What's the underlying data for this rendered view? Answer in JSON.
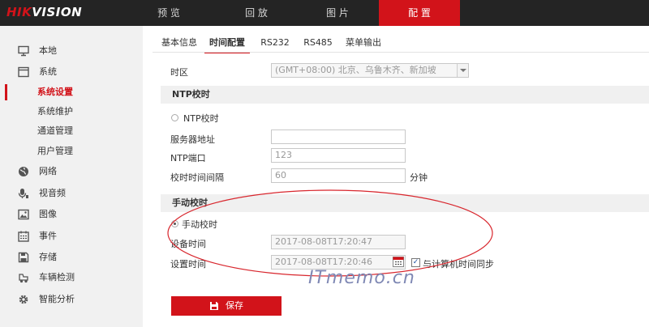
{
  "brand": {
    "logo_red": "HIK",
    "logo_white": "VISION"
  },
  "topnav": [
    "预 览",
    "回 放",
    "图 片",
    "配 置"
  ],
  "sidebar": {
    "items": [
      {
        "label": "本地",
        "icon": "monitor-icon"
      },
      {
        "label": "系统",
        "icon": "window-icon"
      },
      {
        "label": "系统设置"
      },
      {
        "label": "系统维护"
      },
      {
        "label": "通道管理"
      },
      {
        "label": "用户管理"
      },
      {
        "label": "网络",
        "icon": "globe-icon"
      },
      {
        "label": "视音频",
        "icon": "mic-icon"
      },
      {
        "label": "图像",
        "icon": "image-icon"
      },
      {
        "label": "事件",
        "icon": "calendar-icon"
      },
      {
        "label": "存储",
        "icon": "disk-icon"
      },
      {
        "label": "车辆检测",
        "icon": "car-icon"
      },
      {
        "label": "智能分析",
        "icon": "gear-icon"
      }
    ]
  },
  "tabs": [
    "基本信息",
    "时间配置",
    "RS232",
    "RS485",
    "菜单输出"
  ],
  "form": {
    "timezone_label": "时区",
    "timezone_value": "(GMT+08:00) 北京、乌鲁木齐、新加坡",
    "ntp_section": "NTP校时",
    "ntp_radio": "NTP校时",
    "server_label": "服务器地址",
    "server_value": "",
    "port_label": "NTP端口",
    "port_value": "123",
    "interval_label": "校时时间间隔",
    "interval_value": "60",
    "interval_unit": "分钟",
    "manual_section": "手动校时",
    "manual_radio": "手动校时",
    "device_time_label": "设备时间",
    "device_time_value": "2017-08-08T17:20:47",
    "set_time_label": "设置时间",
    "set_time_value": "2017-08-08T17:20:46",
    "sync_label": "与计算机时间同步",
    "sync_checked": "✓"
  },
  "save_label": "保存",
  "watermark": "ITmemo.cn",
  "colors": {
    "accent": "#d2131a",
    "topbar": "#242424",
    "sidebar": "#f1f1f1",
    "annotation": "#d8262d"
  }
}
